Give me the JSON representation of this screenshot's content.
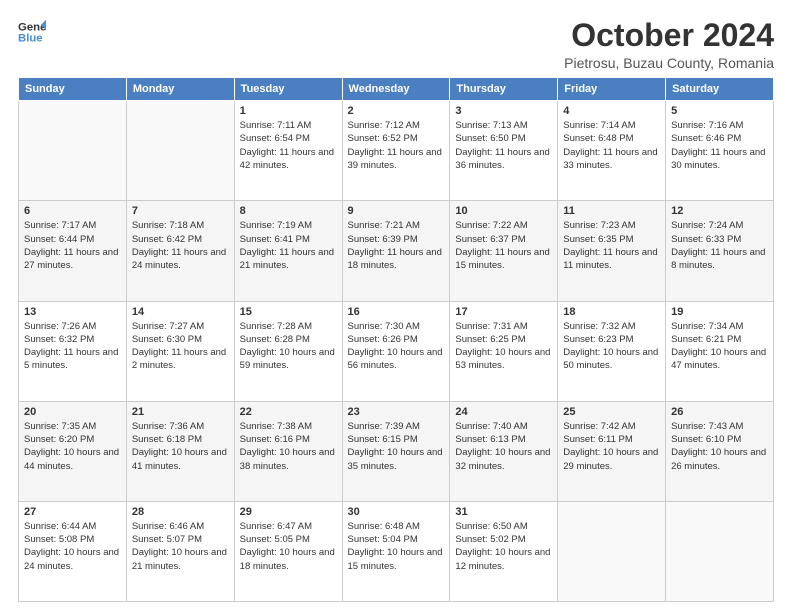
{
  "header": {
    "logo_line1": "General",
    "logo_line2": "Blue",
    "title": "October 2024",
    "subtitle": "Pietrosu, Buzau County, Romania"
  },
  "calendar": {
    "days_of_week": [
      "Sunday",
      "Monday",
      "Tuesday",
      "Wednesday",
      "Thursday",
      "Friday",
      "Saturday"
    ],
    "weeks": [
      [
        {
          "day": "",
          "info": ""
        },
        {
          "day": "",
          "info": ""
        },
        {
          "day": "1",
          "info": "Sunrise: 7:11 AM\nSunset: 6:54 PM\nDaylight: 11 hours and 42 minutes."
        },
        {
          "day": "2",
          "info": "Sunrise: 7:12 AM\nSunset: 6:52 PM\nDaylight: 11 hours and 39 minutes."
        },
        {
          "day": "3",
          "info": "Sunrise: 7:13 AM\nSunset: 6:50 PM\nDaylight: 11 hours and 36 minutes."
        },
        {
          "day": "4",
          "info": "Sunrise: 7:14 AM\nSunset: 6:48 PM\nDaylight: 11 hours and 33 minutes."
        },
        {
          "day": "5",
          "info": "Sunrise: 7:16 AM\nSunset: 6:46 PM\nDaylight: 11 hours and 30 minutes."
        }
      ],
      [
        {
          "day": "6",
          "info": "Sunrise: 7:17 AM\nSunset: 6:44 PM\nDaylight: 11 hours and 27 minutes."
        },
        {
          "day": "7",
          "info": "Sunrise: 7:18 AM\nSunset: 6:42 PM\nDaylight: 11 hours and 24 minutes."
        },
        {
          "day": "8",
          "info": "Sunrise: 7:19 AM\nSunset: 6:41 PM\nDaylight: 11 hours and 21 minutes."
        },
        {
          "day": "9",
          "info": "Sunrise: 7:21 AM\nSunset: 6:39 PM\nDaylight: 11 hours and 18 minutes."
        },
        {
          "day": "10",
          "info": "Sunrise: 7:22 AM\nSunset: 6:37 PM\nDaylight: 11 hours and 15 minutes."
        },
        {
          "day": "11",
          "info": "Sunrise: 7:23 AM\nSunset: 6:35 PM\nDaylight: 11 hours and 11 minutes."
        },
        {
          "day": "12",
          "info": "Sunrise: 7:24 AM\nSunset: 6:33 PM\nDaylight: 11 hours and 8 minutes."
        }
      ],
      [
        {
          "day": "13",
          "info": "Sunrise: 7:26 AM\nSunset: 6:32 PM\nDaylight: 11 hours and 5 minutes."
        },
        {
          "day": "14",
          "info": "Sunrise: 7:27 AM\nSunset: 6:30 PM\nDaylight: 11 hours and 2 minutes."
        },
        {
          "day": "15",
          "info": "Sunrise: 7:28 AM\nSunset: 6:28 PM\nDaylight: 10 hours and 59 minutes."
        },
        {
          "day": "16",
          "info": "Sunrise: 7:30 AM\nSunset: 6:26 PM\nDaylight: 10 hours and 56 minutes."
        },
        {
          "day": "17",
          "info": "Sunrise: 7:31 AM\nSunset: 6:25 PM\nDaylight: 10 hours and 53 minutes."
        },
        {
          "day": "18",
          "info": "Sunrise: 7:32 AM\nSunset: 6:23 PM\nDaylight: 10 hours and 50 minutes."
        },
        {
          "day": "19",
          "info": "Sunrise: 7:34 AM\nSunset: 6:21 PM\nDaylight: 10 hours and 47 minutes."
        }
      ],
      [
        {
          "day": "20",
          "info": "Sunrise: 7:35 AM\nSunset: 6:20 PM\nDaylight: 10 hours and 44 minutes."
        },
        {
          "day": "21",
          "info": "Sunrise: 7:36 AM\nSunset: 6:18 PM\nDaylight: 10 hours and 41 minutes."
        },
        {
          "day": "22",
          "info": "Sunrise: 7:38 AM\nSunset: 6:16 PM\nDaylight: 10 hours and 38 minutes."
        },
        {
          "day": "23",
          "info": "Sunrise: 7:39 AM\nSunset: 6:15 PM\nDaylight: 10 hours and 35 minutes."
        },
        {
          "day": "24",
          "info": "Sunrise: 7:40 AM\nSunset: 6:13 PM\nDaylight: 10 hours and 32 minutes."
        },
        {
          "day": "25",
          "info": "Sunrise: 7:42 AM\nSunset: 6:11 PM\nDaylight: 10 hours and 29 minutes."
        },
        {
          "day": "26",
          "info": "Sunrise: 7:43 AM\nSunset: 6:10 PM\nDaylight: 10 hours and 26 minutes."
        }
      ],
      [
        {
          "day": "27",
          "info": "Sunrise: 6:44 AM\nSunset: 5:08 PM\nDaylight: 10 hours and 24 minutes."
        },
        {
          "day": "28",
          "info": "Sunrise: 6:46 AM\nSunset: 5:07 PM\nDaylight: 10 hours and 21 minutes."
        },
        {
          "day": "29",
          "info": "Sunrise: 6:47 AM\nSunset: 5:05 PM\nDaylight: 10 hours and 18 minutes."
        },
        {
          "day": "30",
          "info": "Sunrise: 6:48 AM\nSunset: 5:04 PM\nDaylight: 10 hours and 15 minutes."
        },
        {
          "day": "31",
          "info": "Sunrise: 6:50 AM\nSunset: 5:02 PM\nDaylight: 10 hours and 12 minutes."
        },
        {
          "day": "",
          "info": ""
        },
        {
          "day": "",
          "info": ""
        }
      ]
    ]
  }
}
